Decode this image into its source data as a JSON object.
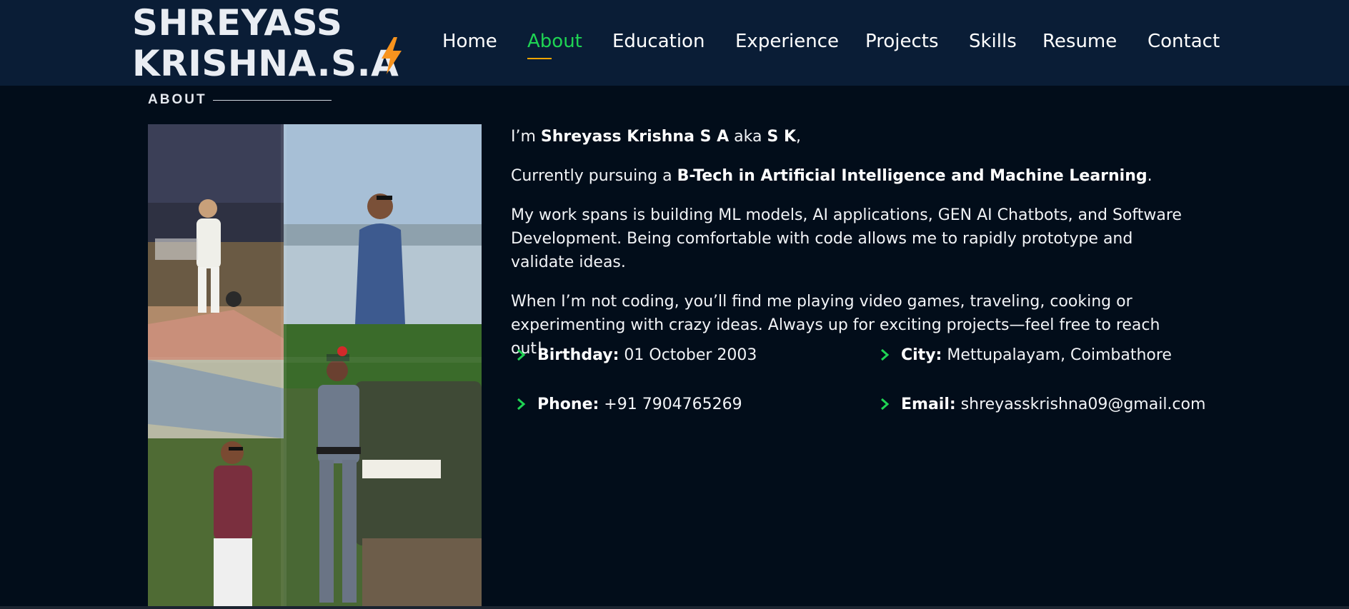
{
  "header": {
    "logo_line1": "SHREYASS",
    "logo_line2": "KRISHNA.S.A",
    "nav": [
      {
        "label": "Home"
      },
      {
        "label": "About"
      },
      {
        "label": "Education"
      },
      {
        "label": "Experience"
      },
      {
        "label": "Projects"
      },
      {
        "label": "Skills"
      },
      {
        "label": "Resume"
      },
      {
        "label": "Contact"
      }
    ],
    "active_nav": "About"
  },
  "about": {
    "section_label": "ABOUT",
    "intro_prefix": "I’m ",
    "name": "Shreyass Krishna S A",
    "aka_text": " aka ",
    "nickname": "S K",
    "intro_suffix": ",",
    "pursuing_prefix": "Currently pursuing a ",
    "degree": "B-Tech in Artificial Intelligence and Machine Learning",
    "pursuing_suffix": ".",
    "work_paragraph": "My work spans is building ML models, AI applications, GEN AI Chatbots, and Software Development. Being comfortable with code allows me to rapidly prototype and validate ideas.",
    "hobby_paragraph": "When I’m not coding, you’ll find me playing video games, traveling, cooking or experimenting with crazy ideas. Always up for exciting projects—feel free to reach out!",
    "info": {
      "birthday_label": "Birthday:",
      "birthday_value": " 01 October 2003",
      "city_label": "City:",
      "city_value": " Mettupalayam, Coimbathore",
      "phone_label": "Phone:",
      "phone_value": " +91 7904765269",
      "email_label": "Email:",
      "email_value": " shreyasskrishna09@gmail.com"
    },
    "collage_icon": "photo-collage-image",
    "chevron_icon": "chevron-right-icon"
  },
  "colors": {
    "page_bg": "#020d1a",
    "header_bg": "#0a1d36",
    "accent_green": "#1fd453",
    "accent_orange": "#f7931e",
    "underline": "#f0a500"
  }
}
